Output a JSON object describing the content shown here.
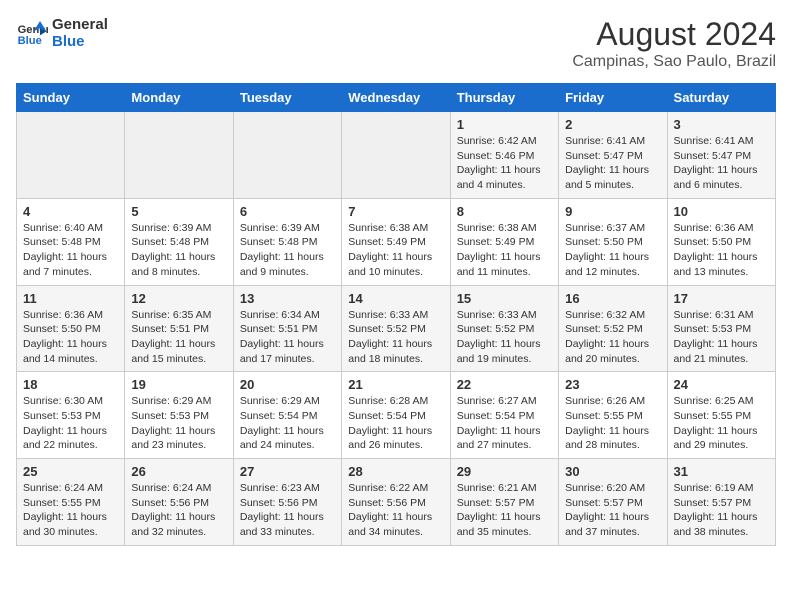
{
  "header": {
    "logo_line1": "General",
    "logo_line2": "Blue",
    "title": "August 2024",
    "subtitle": "Campinas, Sao Paulo, Brazil"
  },
  "weekdays": [
    "Sunday",
    "Monday",
    "Tuesday",
    "Wednesday",
    "Thursday",
    "Friday",
    "Saturday"
  ],
  "weeks": [
    [
      {
        "day": "",
        "info": ""
      },
      {
        "day": "",
        "info": ""
      },
      {
        "day": "",
        "info": ""
      },
      {
        "day": "",
        "info": ""
      },
      {
        "day": "1",
        "info": "Sunrise: 6:42 AM\nSunset: 5:46 PM\nDaylight: 11 hours\nand 4 minutes."
      },
      {
        "day": "2",
        "info": "Sunrise: 6:41 AM\nSunset: 5:47 PM\nDaylight: 11 hours\nand 5 minutes."
      },
      {
        "day": "3",
        "info": "Sunrise: 6:41 AM\nSunset: 5:47 PM\nDaylight: 11 hours\nand 6 minutes."
      }
    ],
    [
      {
        "day": "4",
        "info": "Sunrise: 6:40 AM\nSunset: 5:48 PM\nDaylight: 11 hours\nand 7 minutes."
      },
      {
        "day": "5",
        "info": "Sunrise: 6:39 AM\nSunset: 5:48 PM\nDaylight: 11 hours\nand 8 minutes."
      },
      {
        "day": "6",
        "info": "Sunrise: 6:39 AM\nSunset: 5:48 PM\nDaylight: 11 hours\nand 9 minutes."
      },
      {
        "day": "7",
        "info": "Sunrise: 6:38 AM\nSunset: 5:49 PM\nDaylight: 11 hours\nand 10 minutes."
      },
      {
        "day": "8",
        "info": "Sunrise: 6:38 AM\nSunset: 5:49 PM\nDaylight: 11 hours\nand 11 minutes."
      },
      {
        "day": "9",
        "info": "Sunrise: 6:37 AM\nSunset: 5:50 PM\nDaylight: 11 hours\nand 12 minutes."
      },
      {
        "day": "10",
        "info": "Sunrise: 6:36 AM\nSunset: 5:50 PM\nDaylight: 11 hours\nand 13 minutes."
      }
    ],
    [
      {
        "day": "11",
        "info": "Sunrise: 6:36 AM\nSunset: 5:50 PM\nDaylight: 11 hours\nand 14 minutes."
      },
      {
        "day": "12",
        "info": "Sunrise: 6:35 AM\nSunset: 5:51 PM\nDaylight: 11 hours\nand 15 minutes."
      },
      {
        "day": "13",
        "info": "Sunrise: 6:34 AM\nSunset: 5:51 PM\nDaylight: 11 hours\nand 17 minutes."
      },
      {
        "day": "14",
        "info": "Sunrise: 6:33 AM\nSunset: 5:52 PM\nDaylight: 11 hours\nand 18 minutes."
      },
      {
        "day": "15",
        "info": "Sunrise: 6:33 AM\nSunset: 5:52 PM\nDaylight: 11 hours\nand 19 minutes."
      },
      {
        "day": "16",
        "info": "Sunrise: 6:32 AM\nSunset: 5:52 PM\nDaylight: 11 hours\nand 20 minutes."
      },
      {
        "day": "17",
        "info": "Sunrise: 6:31 AM\nSunset: 5:53 PM\nDaylight: 11 hours\nand 21 minutes."
      }
    ],
    [
      {
        "day": "18",
        "info": "Sunrise: 6:30 AM\nSunset: 5:53 PM\nDaylight: 11 hours\nand 22 minutes."
      },
      {
        "day": "19",
        "info": "Sunrise: 6:29 AM\nSunset: 5:53 PM\nDaylight: 11 hours\nand 23 minutes."
      },
      {
        "day": "20",
        "info": "Sunrise: 6:29 AM\nSunset: 5:54 PM\nDaylight: 11 hours\nand 24 minutes."
      },
      {
        "day": "21",
        "info": "Sunrise: 6:28 AM\nSunset: 5:54 PM\nDaylight: 11 hours\nand 26 minutes."
      },
      {
        "day": "22",
        "info": "Sunrise: 6:27 AM\nSunset: 5:54 PM\nDaylight: 11 hours\nand 27 minutes."
      },
      {
        "day": "23",
        "info": "Sunrise: 6:26 AM\nSunset: 5:55 PM\nDaylight: 11 hours\nand 28 minutes."
      },
      {
        "day": "24",
        "info": "Sunrise: 6:25 AM\nSunset: 5:55 PM\nDaylight: 11 hours\nand 29 minutes."
      }
    ],
    [
      {
        "day": "25",
        "info": "Sunrise: 6:24 AM\nSunset: 5:55 PM\nDaylight: 11 hours\nand 30 minutes."
      },
      {
        "day": "26",
        "info": "Sunrise: 6:24 AM\nSunset: 5:56 PM\nDaylight: 11 hours\nand 32 minutes."
      },
      {
        "day": "27",
        "info": "Sunrise: 6:23 AM\nSunset: 5:56 PM\nDaylight: 11 hours\nand 33 minutes."
      },
      {
        "day": "28",
        "info": "Sunrise: 6:22 AM\nSunset: 5:56 PM\nDaylight: 11 hours\nand 34 minutes."
      },
      {
        "day": "29",
        "info": "Sunrise: 6:21 AM\nSunset: 5:57 PM\nDaylight: 11 hours\nand 35 minutes."
      },
      {
        "day": "30",
        "info": "Sunrise: 6:20 AM\nSunset: 5:57 PM\nDaylight: 11 hours\nand 37 minutes."
      },
      {
        "day": "31",
        "info": "Sunrise: 6:19 AM\nSunset: 5:57 PM\nDaylight: 11 hours\nand 38 minutes."
      }
    ]
  ]
}
